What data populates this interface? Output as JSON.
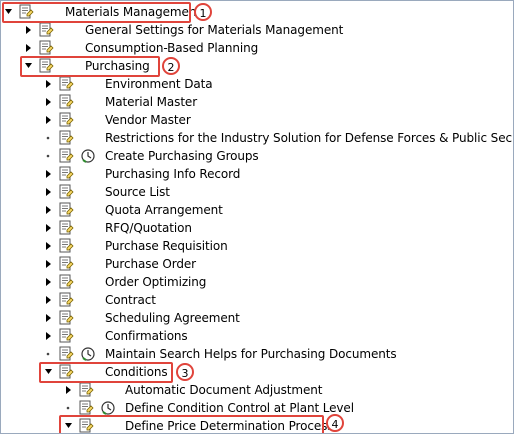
{
  "tree": {
    "materials_management": "Materials Management",
    "general_settings": "General Settings for Materials Management",
    "consumption_planning": "Consumption-Based Planning",
    "purchasing": "Purchasing",
    "environment_data": "Environment Data",
    "material_master": "Material Master",
    "vendor_master": "Vendor Master",
    "restrictions": "Restrictions for the Industry Solution for Defense Forces & Public Security",
    "create_purchasing_groups": "Create Purchasing Groups",
    "purchasing_info_record": "Purchasing Info Record",
    "source_list": "Source List",
    "quota_arrangement": "Quota Arrangement",
    "rfq_quotation": "RFQ/Quotation",
    "purchase_requisition": "Purchase Requisition",
    "purchase_order": "Purchase Order",
    "order_optimizing": "Order Optimizing",
    "contract": "Contract",
    "scheduling_agreement": "Scheduling Agreement",
    "confirmations": "Confirmations",
    "maintain_search_helps": "Maintain Search Helps for Purchasing Documents",
    "conditions": "Conditions",
    "automatic_document_adjustment": "Automatic Document Adjustment",
    "define_condition_control": "Define Condition Control at Plant Level",
    "define_price_determination": "Define Price Determination Process"
  },
  "callouts": {
    "step1": "1",
    "step2": "2",
    "step3": "3",
    "step4": "4"
  },
  "colors": {
    "highlight": "#e0443b",
    "frame": "#9aa9bd"
  },
  "icons": {
    "node": "activity-document-icon",
    "clock": "clock-activity-icon",
    "expanded": "triangle-down-icon",
    "collapsed": "triangle-right-icon",
    "leaf": "leaf-dot-icon"
  }
}
